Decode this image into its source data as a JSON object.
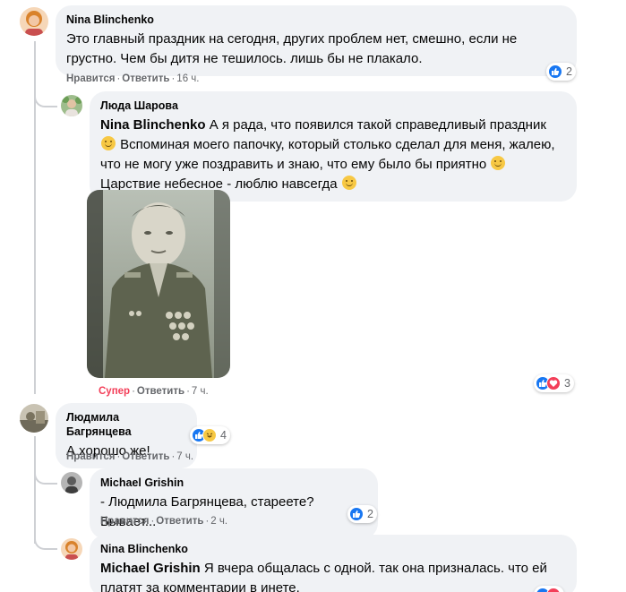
{
  "comments": [
    {
      "author": "Nina Blinchenko",
      "text": "Это главный праздник на сегодня, других проблем нет, смешно, если не грустно. Чем бы дитя не тешилось. лишь бы не плакало.",
      "actions": {
        "like": "Нравится",
        "reply": "Ответить",
        "time": "16 ч."
      },
      "reactions": {
        "count": "2",
        "types": [
          "like"
        ]
      }
    },
    {
      "author": "Люда Шарова",
      "mention": "Nina Blinchenko",
      "text_parts": [
        "А я рада, что появился такой справедливый праздник",
        "Вспоминая моего папочку, который столько сделал для меня, жалею, что не могу уже поздравить и знаю, что ему было бы приятно",
        "Царствие небесное - люблю навсегда"
      ],
      "has_photo": true,
      "actions": {
        "like": "Супер",
        "reply": "Ответить",
        "time": "7 ч."
      },
      "reactions": {
        "count": "3",
        "types": [
          "like",
          "love"
        ]
      }
    },
    {
      "author": "Людмила Багрянцева",
      "text": "А хорошо же!",
      "actions": {
        "like": "Нравится",
        "reply": "Ответить",
        "time": "7 ч."
      },
      "reactions": {
        "count": "4",
        "types": [
          "like",
          "haha"
        ]
      }
    },
    {
      "author": "Michael Grishin",
      "text": "- Людмила Багрянцева, стареете? Бывает...",
      "actions": {
        "like": "Нравится",
        "reply": "Ответить",
        "time": "2 ч."
      },
      "reactions": {
        "count": "2",
        "types": [
          "like"
        ]
      }
    },
    {
      "author": "Nina Blinchenko",
      "mention": "Michael Grishin",
      "text": "Я вчера общалась с одной. так она призналась. что ей платят за комментарии в инете.",
      "reactions": {
        "types": [
          "like",
          "love"
        ]
      }
    }
  ],
  "colors": {
    "bubble": "#f0f2f5",
    "meta": "#65676b",
    "like_blue": "#1877f2",
    "love_red": "#f33e58",
    "super_red": "#f33e58",
    "thread_line": "#ced0d4"
  },
  "icons": {
    "like": "thumbs-up-icon",
    "love": "heart-icon",
    "haha": "laugh-icon",
    "smile": "smile-emoji-icon"
  }
}
